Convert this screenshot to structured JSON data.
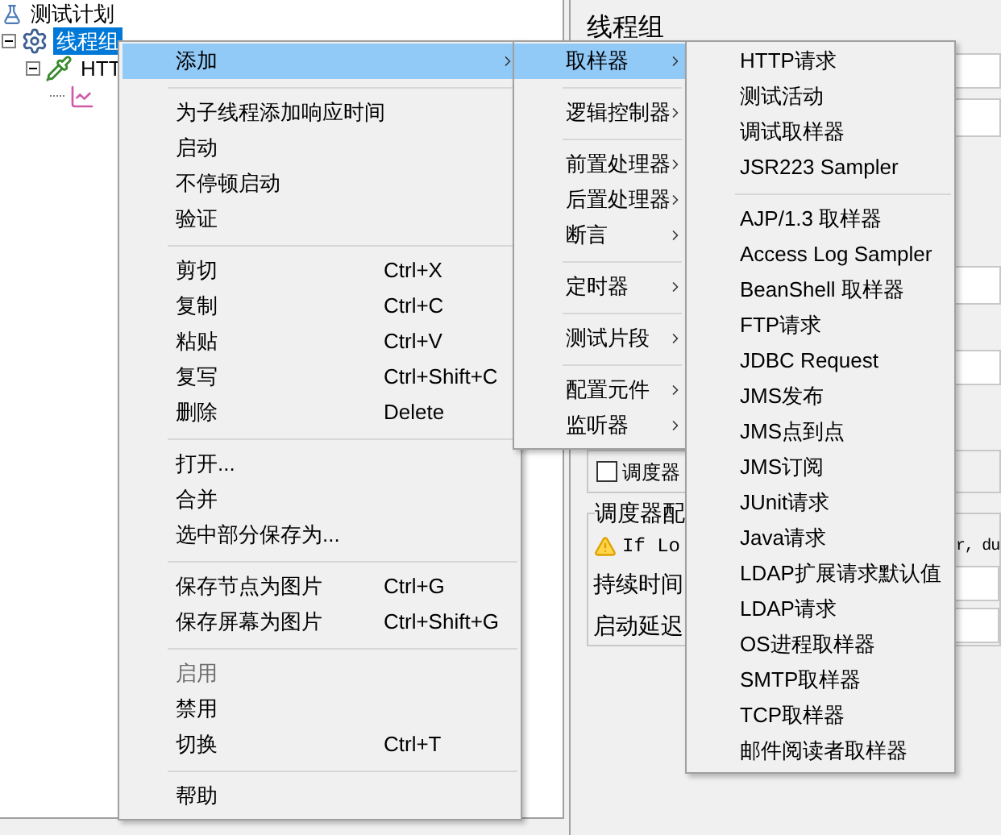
{
  "tree": [
    {
      "label": "测试计划",
      "kind": "plan",
      "children": [
        {
          "label": "线程组",
          "kind": "thread_group",
          "selected": true,
          "expanded": true,
          "children": [
            {
              "label": "HTT",
              "kind": "sampler",
              "selected": false,
              "expanded": true,
              "children": [
                {
                  "kind": "listener"
                }
              ]
            }
          ]
        }
      ]
    }
  ],
  "panel": {
    "title": "线程组",
    "scheduler_checkbox": {
      "label": "调度器",
      "checked": false
    },
    "scheduler_group": {
      "legend": "调度器配",
      "warning_start": "If Lo",
      "warning_end": "r, du",
      "fields": [
        {
          "label": "持续时间"
        },
        {
          "label": "启动延迟"
        }
      ]
    }
  },
  "context_menu": {
    "groups": [
      [
        {
          "label": "添加",
          "submenu": true,
          "selected": true,
          "disabled": false
        }
      ],
      [
        {
          "label": "为子线程添加响应时间",
          "submenu": false,
          "selected": false,
          "disabled": false
        },
        {
          "label": "启动",
          "submenu": false,
          "selected": false,
          "disabled": false
        },
        {
          "label": "不停顿启动",
          "submenu": false,
          "selected": false,
          "disabled": false
        },
        {
          "label": "验证",
          "submenu": false,
          "selected": false,
          "disabled": false
        }
      ],
      [
        {
          "label": "剪切",
          "shortcut": "Ctrl+X",
          "submenu": false,
          "selected": false,
          "disabled": false
        },
        {
          "label": "复制",
          "shortcut": "Ctrl+C",
          "submenu": false,
          "selected": false,
          "disabled": false
        },
        {
          "label": "粘贴",
          "shortcut": "Ctrl+V",
          "submenu": false,
          "selected": false,
          "disabled": false
        },
        {
          "label": "复写",
          "shortcut": "Ctrl+Shift+C",
          "submenu": false,
          "selected": false,
          "disabled": false
        },
        {
          "label": "删除",
          "shortcut": "Delete",
          "submenu": false,
          "selected": false,
          "disabled": false
        }
      ],
      [
        {
          "label": "打开...",
          "submenu": false,
          "selected": false,
          "disabled": false
        },
        {
          "label": "合并",
          "submenu": false,
          "selected": false,
          "disabled": false
        },
        {
          "label": "选中部分保存为...",
          "submenu": false,
          "selected": false,
          "disabled": false
        }
      ],
      [
        {
          "label": "保存节点为图片",
          "shortcut": "Ctrl+G",
          "submenu": false,
          "selected": false,
          "disabled": false
        },
        {
          "label": "保存屏幕为图片",
          "shortcut": "Ctrl+Shift+G",
          "submenu": false,
          "selected": false,
          "disabled": false
        }
      ],
      [
        {
          "label": "启用",
          "submenu": false,
          "selected": false,
          "disabled": true
        },
        {
          "label": "禁用",
          "submenu": false,
          "selected": false,
          "disabled": false
        },
        {
          "label": "切换",
          "shortcut": "Ctrl+T",
          "submenu": false,
          "selected": false,
          "disabled": false
        }
      ],
      [
        {
          "label": "帮助",
          "submenu": false,
          "selected": false,
          "disabled": false
        }
      ]
    ]
  },
  "add_submenu": {
    "groups": [
      [
        {
          "label": "取样器",
          "selected": true
        }
      ],
      [
        {
          "label": "逻辑控制器",
          "selected": false
        }
      ],
      [
        {
          "label": "前置处理器",
          "selected": false
        },
        {
          "label": "后置处理器",
          "selected": false
        },
        {
          "label": "断言",
          "selected": false
        }
      ],
      [
        {
          "label": "定时器",
          "selected": false
        }
      ],
      [
        {
          "label": "测试片段",
          "selected": false
        }
      ],
      [
        {
          "label": "配置元件",
          "selected": false
        },
        {
          "label": "监听器",
          "selected": false
        }
      ]
    ]
  },
  "sampler_submenu": {
    "groups": [
      [
        {
          "label": "HTTP请求",
          "selected": false
        },
        {
          "label": "测试活动",
          "selected": false
        },
        {
          "label": "调试取样器",
          "selected": false
        },
        {
          "label": "JSR223 Sampler",
          "selected": false
        }
      ],
      [
        {
          "label": "AJP/1.3 取样器",
          "selected": false
        },
        {
          "label": "Access Log Sampler",
          "selected": false
        },
        {
          "label": "BeanShell 取样器",
          "selected": false
        },
        {
          "label": "FTP请求",
          "selected": false
        },
        {
          "label": "JDBC Request",
          "selected": false
        },
        {
          "label": "JMS发布",
          "selected": false
        },
        {
          "label": "JMS点到点",
          "selected": false
        },
        {
          "label": "JMS订阅",
          "selected": false
        },
        {
          "label": "JUnit请求",
          "selected": false
        },
        {
          "label": "Java请求",
          "selected": false
        },
        {
          "label": "LDAP扩展请求默认值",
          "selected": false
        },
        {
          "label": "LDAP请求",
          "selected": false
        },
        {
          "label": "OS进程取样器",
          "selected": false
        },
        {
          "label": "SMTP取样器",
          "selected": false
        },
        {
          "label": "TCP取样器",
          "selected": false
        },
        {
          "label": "邮件阅读者取样器",
          "selected": false
        }
      ]
    ]
  }
}
